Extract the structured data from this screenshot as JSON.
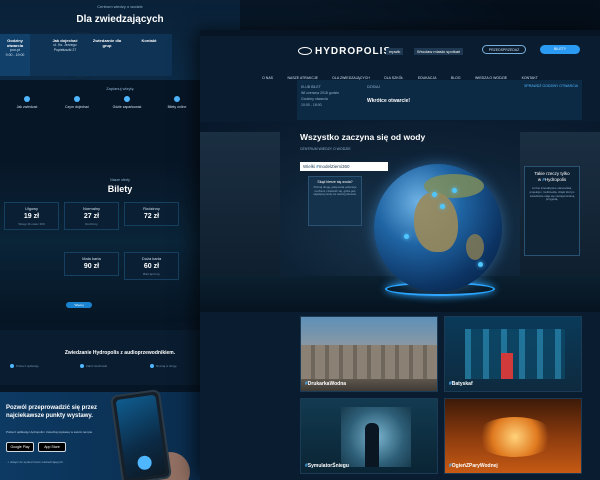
{
  "left_page": {
    "kicker": "Centrum wiedzy o wodzie",
    "title": "Dla zwiedzających",
    "strip": [
      {
        "label": "Godziny otwarcia",
        "lines": [
          "pon-pt",
          "9:00 - 19:00"
        ]
      },
      {
        "label": "Jak dojechać",
        "lines": [
          "ul. Ks. Jerzego",
          "Popiełuszki 27"
        ]
      },
      {
        "label": "Zwiedzanie dla grup",
        "lines": [
          "",
          ""
        ]
      },
      {
        "label": "Kontakt",
        "lines": [
          "",
          ""
        ]
      }
    ],
    "small_heading": "Zaplanuj wizytę",
    "features": [
      {
        "title": "Jak zwiedzać",
        "desc": ""
      },
      {
        "title": "Czym dojechać",
        "desc": ""
      },
      {
        "title": "Gdzie zaparkować",
        "desc": ""
      },
      {
        "title": "Bilety online",
        "desc": ""
      }
    ],
    "tickets_kicker": "Nasze oferty",
    "tickets_title": "Bilety",
    "ticket_cards": [
      {
        "name": "Ulgowy",
        "price": "19 zł",
        "note": "Wstęp M-owiec 360"
      },
      {
        "name": "Normalny",
        "price": "27 zł",
        "note": "Rodzinny"
      },
      {
        "name": "Rodzinny",
        "price": "72 zł",
        "note": ""
      },
      {
        "name": "Mała karta",
        "price": "90 zł",
        "note": ""
      },
      {
        "name": "Duża karta",
        "price": "60 zł",
        "note": "Bilet łączony"
      }
    ],
    "tickets_button": "Więcej",
    "audio_heading": "Zwiedzanie Hydropolis z audioprzewodnikiem.",
    "audio_cols": [
      "Pobierz aplikację",
      "Załóż słuchawki",
      "Ruszaj w drogę"
    ],
    "app_heading": "Pozwól przeprowadzić się przez najciekawsze punkty wystawy.",
    "app_sub": "Pobierz aplikację Hydropolis i zwiedzaj wystawę w swoim tempie.",
    "store_google": "Google Play",
    "store_apple": "App Store",
    "app_note": "...i dołącz do społeczności odwiedzających."
  },
  "main_page": {
    "logo": "HYDROPOLIS",
    "partners": [
      "mpwik",
      "Wrocław miasto spotkań"
    ],
    "btn_outline": "PRZEDSPRZEDAŻ",
    "btn_fill": "BILETY",
    "nav": [
      "O NAS",
      "NASZE ATRAKCJE",
      "DLA ZWIEDZAJĄCYCH",
      "DLA SZKÓŁ",
      "EDUKACJA",
      "BLOG",
      "WIEDZA O WODZIE",
      "KONTAKT"
    ],
    "hours": {
      "col1_lines": [
        "KLUB BILET",
        "",
        "Wt czerwca 2018 godzin",
        "Godziny otwarcia",
        "10:00 - 18:00"
      ],
      "col2_label": "DZISIAJ",
      "col2_big": "Wkrótce otwarcie!",
      "more": "SPRAWDŹ GODZINY OTWARCIA"
    },
    "scene": {
      "title": "Wszystko zaczyna się od wody",
      "sub": "CENTRUM WIEDZY O WODZIE",
      "tag_prefix": "Wielki",
      "tag_hash": "#",
      "tag_name": "modelZiemi360",
      "card_title": "Skąd bierze się woda?",
      "card_desc": "Poznaj drogę, jaką woda pokonuje na Ziemi i dowiedz się, gdzie jest najwięcej wody na naszej planecie.",
      "side_title_1": "Takie rzeczy tylko",
      "side_title_2": "w",
      "side_hash": "#",
      "side_name": "Hydropolis",
      "side_desc": "Liczne interaktywne stanowiska, projekcje i multimedia, dzięki którym zwiedzanie staje się niezapomnianą przygodą."
    },
    "tiles": [
      {
        "hash": "#",
        "name": "DrukarkaWodna"
      },
      {
        "hash": "#",
        "name": "Batyskaf"
      },
      {
        "hash": "#",
        "name": "SymulatorŚniegu"
      },
      {
        "hash": "#",
        "name": "OgieńZParyWodnej"
      }
    ],
    "colors": {
      "accent": "#2b9af3",
      "bg": "#0a1d30",
      "highlight": "#4fb7ff"
    }
  }
}
